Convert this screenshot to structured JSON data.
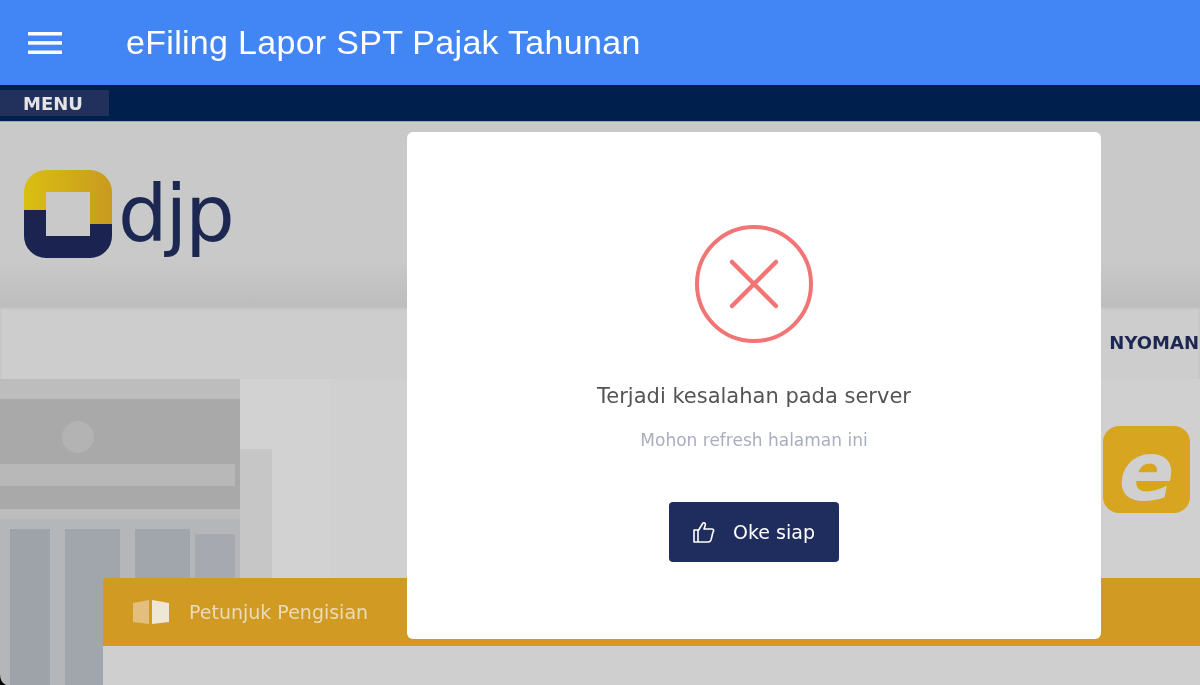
{
  "app_bar": {
    "title": "eFiling Lapor SPT Pajak Tahunan"
  },
  "menu_bar": {
    "label": "MENU"
  },
  "site": {
    "logo_text": "djp",
    "nav_text": "NYOMAN",
    "app_logo_letter": "e",
    "card": {
      "title": "Petunjuk Pengisian"
    }
  },
  "dialog": {
    "kind": "error",
    "title": "Terjadi kesalahan pada server",
    "message": "Mohon refresh halaman ini",
    "button": "Oke siap"
  }
}
